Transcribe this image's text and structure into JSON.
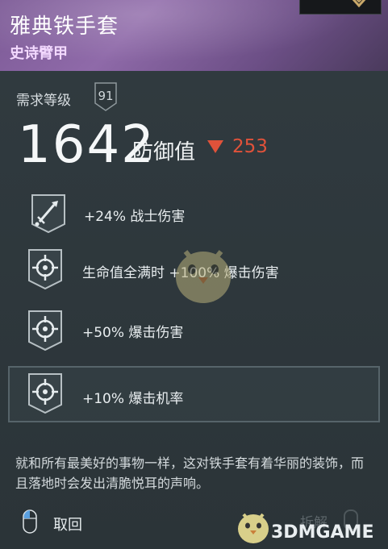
{
  "item": {
    "name": "雅典铁手套",
    "rarity": "史诗臂甲",
    "rarity_color": "#f3d9ff"
  },
  "requirement": {
    "label": "需求等级",
    "level": "91"
  },
  "armor": {
    "value": "1642",
    "label": "防御值",
    "diff": "253",
    "diff_direction": "down",
    "diff_color": "#e0523a"
  },
  "perks": [
    {
      "icon": "sword-icon",
      "text": "+24% 战士伤害"
    },
    {
      "icon": "crosshair-icon",
      "text": "生命值全满时 +100% 爆击伤害"
    },
    {
      "icon": "crosshair-icon",
      "text": "+50% 爆击伤害"
    },
    {
      "icon": "crosshair-icon",
      "text": "+10% 爆击机率"
    }
  ],
  "flavor_text": "就和所有最美好的事物一样，这对铁手套有着华丽的装饰，而且落地时会发出清脆悦耳的声响。",
  "footer": {
    "back_label": "取回",
    "dismantle_label": "拆解"
  },
  "watermark": {
    "text": "3DMGAME"
  }
}
